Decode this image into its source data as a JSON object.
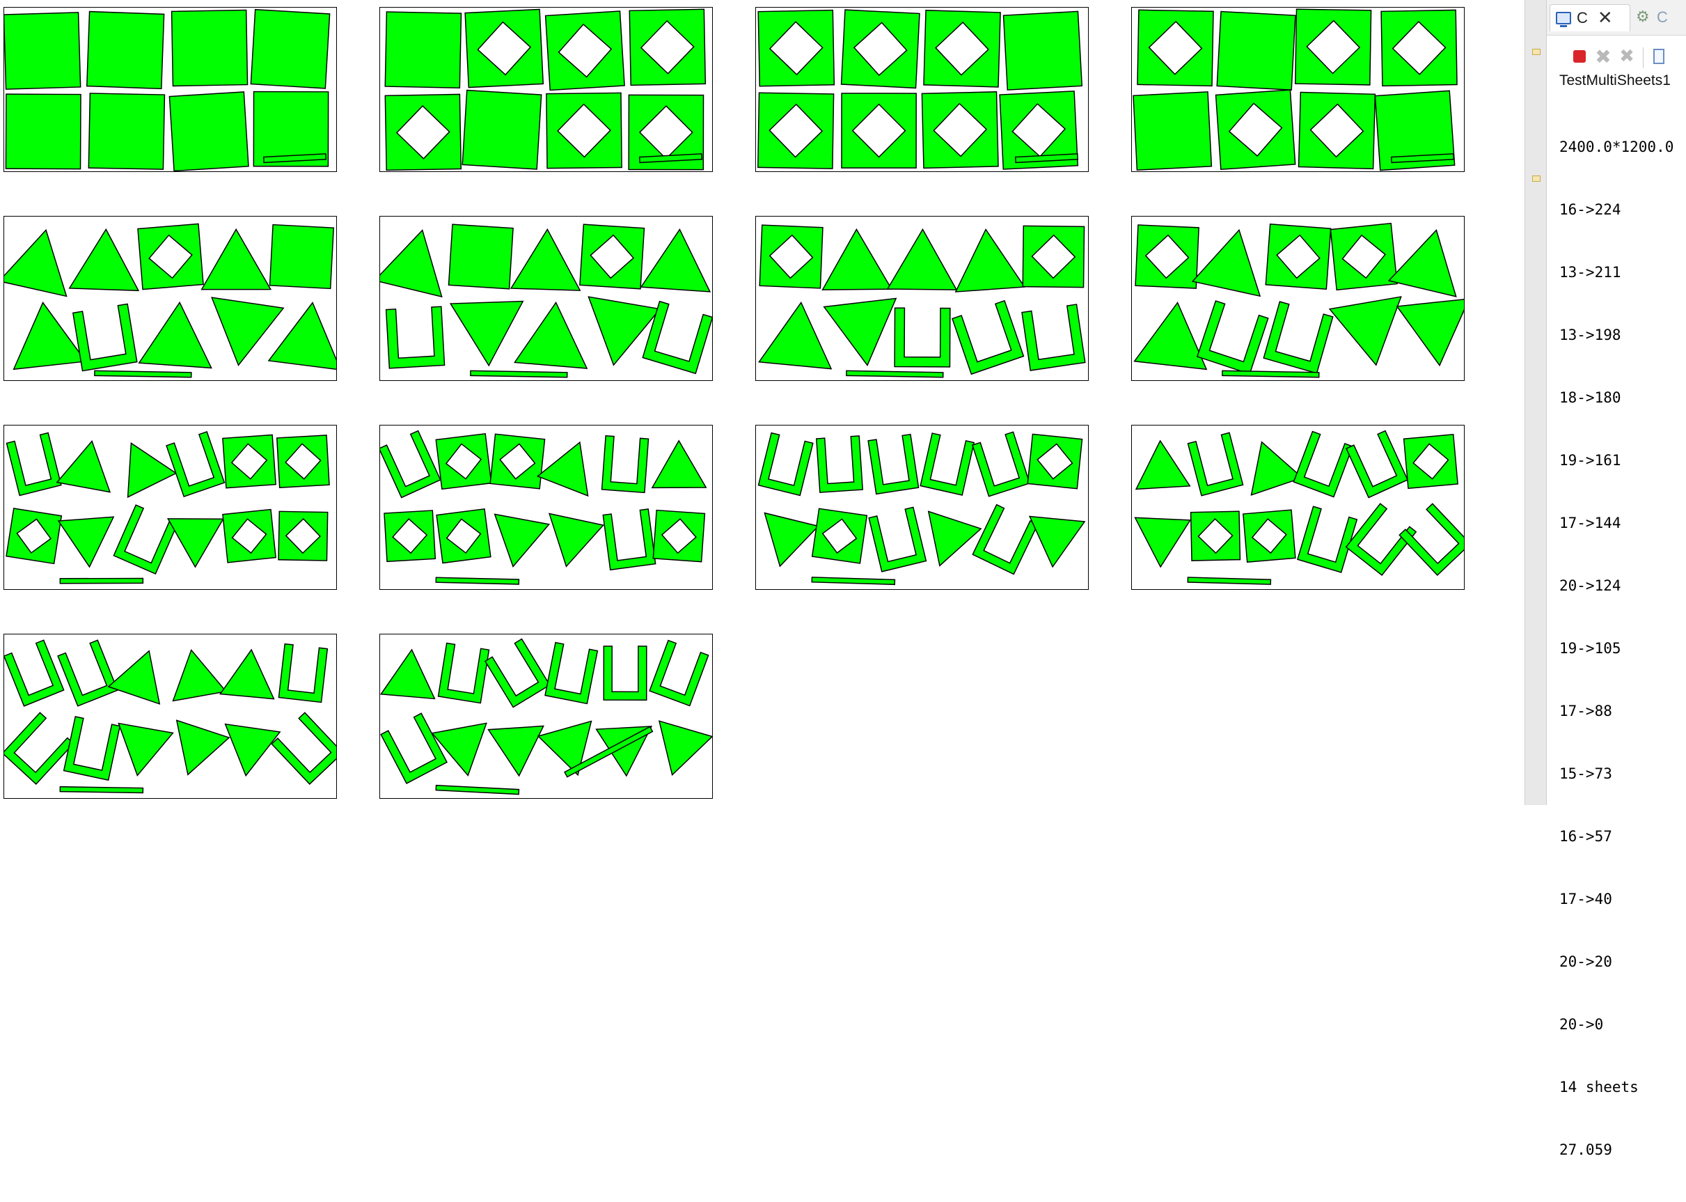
{
  "window": {
    "title": "TestMultiSheets1"
  },
  "colors": {
    "piece_fill": "#00ff00",
    "piece_stroke": "#000000",
    "sheet_border": "#000000",
    "background": "#ffffff"
  },
  "console": {
    "tab_label": "C",
    "other_tab_label": "C",
    "icons": [
      "monitor-icon",
      "close-icon",
      "gears-icon",
      "terminate-icon",
      "remove-launch-icon",
      "remove-all-icon",
      "display-selected-icon"
    ],
    "title": "TestMultiSheets1",
    "lines": [
      "2400.0*1200.0",
      "16->224",
      "13->211",
      "13->198",
      "18->180",
      "19->161",
      "17->144",
      "20->124",
      "19->105",
      "17->88",
      "15->73",
      "16->57",
      "17->40",
      "20->20",
      "20->0",
      "14 sheets",
      "27.059"
    ]
  },
  "sheets": {
    "count": 14,
    "piece_fill": "#00ff00"
  }
}
